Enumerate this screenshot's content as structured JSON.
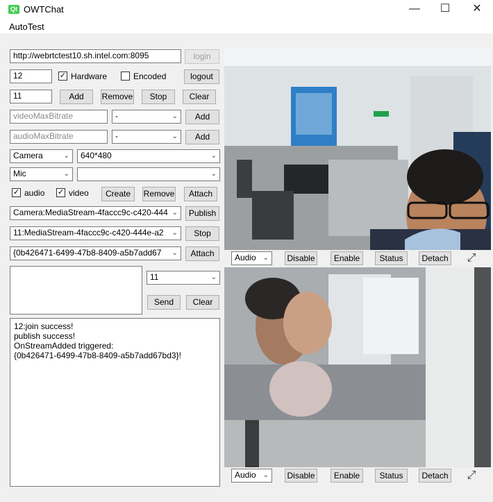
{
  "window": {
    "title": "OWTChat",
    "logo_text": "Qt",
    "minimize_glyph": "—",
    "maximize_glyph": "☐",
    "close_glyph": "✕"
  },
  "menu": {
    "autotest": "AutoTest"
  },
  "login": {
    "server_url": "http://webrtctest10.sh.intel.com:8095",
    "login_label": "login"
  },
  "room": {
    "room_id": "12",
    "hardware_label": "Hardware",
    "hardware_checked": true,
    "encoded_label": "Encoded",
    "encoded_checked": false,
    "logout_label": "logout"
  },
  "stream_ops": {
    "count_value": "11",
    "add_label": "Add",
    "remove_label": "Remove",
    "stop_label": "Stop",
    "clear_label": "Clear"
  },
  "bitrate": {
    "video_placeholder": "videoMaxBitrate",
    "video_select": "-",
    "audio_placeholder": "audioMaxBitrate",
    "audio_select": "-",
    "add_label": "Add"
  },
  "devices": {
    "camera": "Camera",
    "resolution": "640*480",
    "mic": "Mic",
    "mic_device": ""
  },
  "local_stream": {
    "audio_label": "audio",
    "audio_checked": true,
    "video_label": "video",
    "video_checked": true,
    "create_label": "Create",
    "remove_label": "Remove",
    "attach_label": "Attach"
  },
  "streams": {
    "publish_select": "Camera:MediaStream-4faccc9c-c420-444",
    "publish_label": "Publish",
    "stop_select": "11:MediaStream-4faccc9c-c420-444e-a2",
    "stop_label": "Stop",
    "attach_select": "{0b426471-6499-47b8-8409-a5b7add67",
    "attach_label": "Attach"
  },
  "chat": {
    "message": "",
    "target": "11",
    "send_label": "Send",
    "clear_label": "Clear"
  },
  "log_lines": [
    "12:join success!",
    "publish success!",
    "OnStreamAdded triggered:",
    "{0b426471-6499-47b8-8409-a5b7add67bd3}!"
  ],
  "video_controls": {
    "audio": "Audio",
    "disable": "Disable",
    "enable": "Enable",
    "status": "Status",
    "detach": "Detach",
    "fullscreen_icon": "⤢"
  },
  "icons": {
    "checkmark": "✓",
    "chevron": "⌄"
  }
}
